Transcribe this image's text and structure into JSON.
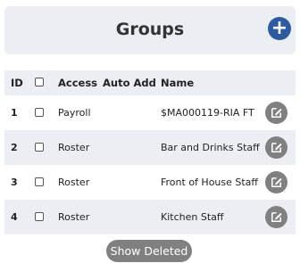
{
  "header": {
    "title": "Groups",
    "add_icon": "plus-icon"
  },
  "table": {
    "columns": {
      "id": "ID",
      "access": "Access",
      "auto_add": "Auto Add",
      "name": "Name"
    },
    "rows": [
      {
        "id": "1",
        "access": "Payroll",
        "auto_add": "",
        "name": "$MA000119-RIA FT"
      },
      {
        "id": "2",
        "access": "Roster",
        "auto_add": "",
        "name": "Bar and Drinks Staff"
      },
      {
        "id": "3",
        "access": "Roster",
        "auto_add": "",
        "name": "Front of House Staff"
      },
      {
        "id": "4",
        "access": "Roster",
        "auto_add": "",
        "name": "Kitchen Staff"
      }
    ],
    "edit_icon": "edit-icon"
  },
  "footer": {
    "show_deleted_label": "Show Deleted"
  },
  "colors": {
    "accent": "#2e5a9f",
    "button_gray": "#808080",
    "stripe": "#ebeff3"
  }
}
